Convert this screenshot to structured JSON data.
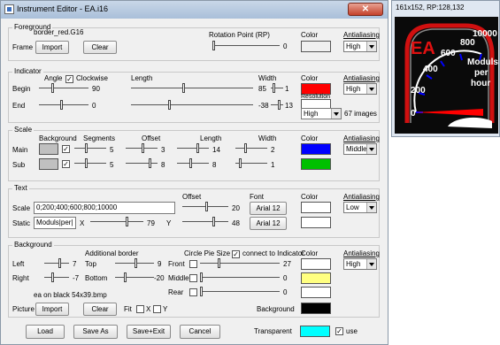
{
  "window": {
    "title": "Instrument Editor - EA.i16",
    "close_label": "✕"
  },
  "foreground": {
    "legend": "Foreground",
    "frame_file": "border_red.G16",
    "frame_label": "Frame",
    "import_label": "Import",
    "clear_label": "Clear",
    "rotation_label": "Rotation Point (RP)",
    "rotation_value": "0",
    "color_label": "Color",
    "color_value": "#ffffff",
    "antialiasing_label": "Antialiasing",
    "antialiasing_value": "High"
  },
  "indicator": {
    "legend": "Indicator",
    "angle_label": "Angle",
    "clockwise_label": "Clockwise",
    "length_label": "Length",
    "width_label": "Width",
    "color_label": "Color",
    "antialiasing_label": "Antialiasing",
    "antialiasing_value": "High",
    "begin_label": "Begin",
    "begin_angle": "90",
    "begin_length": "85",
    "begin_width": "1",
    "begin_color": "#ff0000",
    "end_label": "End",
    "end_angle": "0",
    "end_length": "-38",
    "end_width": "13",
    "end_color": "#ffffff",
    "resolution_label": "Resolution",
    "resolution_value": "High",
    "images_label": "67 images"
  },
  "scale": {
    "legend": "Scale",
    "background_label": "Background",
    "segments_label": "Segments",
    "offset_label": "Offset",
    "length_label": "Length",
    "width_label": "Width",
    "color_label": "Color",
    "antialiasing_label": "Antialiasing",
    "antialiasing_value": "Middle",
    "main_label": "Main",
    "main_segments": "5",
    "main_offset": "3",
    "main_length": "14",
    "main_width": "2",
    "main_color": "#0000ff",
    "sub_label": "Sub",
    "sub_segments": "5",
    "sub_offset": "8",
    "sub_length": "8",
    "sub_width": "1",
    "sub_color": "#00c000"
  },
  "text": {
    "legend": "Text",
    "offset_label": "Offset",
    "font_label": "Font",
    "color_label": "Color",
    "antialiasing_label": "Antialiasing",
    "antialiasing_value": "Low",
    "scale_label": "Scale",
    "scale_value": "0;200;400;600;800;10000",
    "scale_offset": "20",
    "scale_font": "Arial 12",
    "scale_color": "#ffffff",
    "static_label": "Static",
    "static_value": "Moduls|per|",
    "x_label": "X",
    "x_value": "79",
    "y_label": "Y",
    "y_value": "48",
    "static_font": "Arial 12",
    "static_color": "#ffffff"
  },
  "background": {
    "legend": "Background",
    "additional_border_label": "Additional border",
    "circle_pie_size_label": "Circle  Pie  Size",
    "connect_label": "connect to Indicator",
    "color_label": "Color",
    "antialiasing_label": "Antialiasing",
    "antialiasing_value": "High",
    "left_label": "Left",
    "left_value": "7",
    "top_label": "Top",
    "top_value": "9",
    "front_label": "Front",
    "front_value": "27",
    "front_color": "#ffffff",
    "right_label": "Right",
    "right_value": "-7",
    "bottom_label": "Bottom",
    "bottom_value": "-20",
    "middle_label": "Middle",
    "middle_value": "0",
    "middle_color": "#ffff80",
    "rear_label": "Rear",
    "rear_value": "0",
    "rear_color": "#ffffff",
    "picture_file": "ea on black 54x39.bmp",
    "picture_label": "Picture",
    "import_label": "Import",
    "clear_label": "Clear",
    "fit_label": "Fit",
    "fit_x_label": "X",
    "fit_y_label": "Y",
    "background_label": "Background",
    "background_color": "#000000"
  },
  "footer": {
    "load_label": "Load",
    "save_as_label": "Save As",
    "save_exit_label": "Save+Exit",
    "cancel_label": "Cancel",
    "transparent_label": "Transparent",
    "transparent_color": "#00ffff",
    "use_label": "use"
  },
  "preview": {
    "title": "161x152, RP:128,132",
    "badge": "EA",
    "tick_labels": [
      "200",
      "400",
      "600",
      "800",
      "10000"
    ],
    "zero_label": "0",
    "static_lines": [
      "Moduls",
      "per",
      "hour"
    ]
  }
}
